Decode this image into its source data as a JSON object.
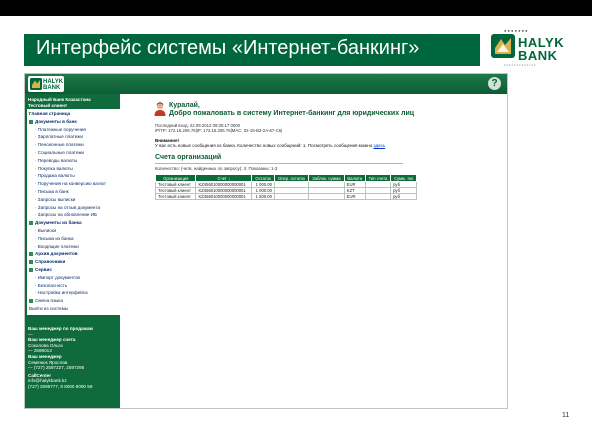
{
  "slide": {
    "title": "Интерфейс системы «Интернет-банкинг»",
    "page_number": "11",
    "brand_color": "#00673c"
  },
  "logo": {
    "dots": "●  ●  ●  ●  ●  ●  ●",
    "line1": "HALYK",
    "line2": "BANK",
    "tagline": "• • • • • • • • • • • • •"
  },
  "app": {
    "logo_line1": "HALYK",
    "logo_line2": "BANK",
    "help_icon": "?",
    "bank_name": "Народный Банк Казахстана",
    "client_name": "Тестовый клиент"
  },
  "menu": [
    {
      "label": "Главная страница",
      "bold": true,
      "icon": false
    },
    {
      "label": "Документы в банк",
      "bold": true,
      "icon": true
    },
    {
      "label": "· Платежные поручения",
      "bold": false,
      "icon": false
    },
    {
      "label": "· Зарплатные платежи",
      "bold": false,
      "icon": false
    },
    {
      "label": "· Пенсионные платежи",
      "bold": false,
      "icon": false
    },
    {
      "label": "· Социальные платежи",
      "bold": false,
      "icon": false
    },
    {
      "label": "· Переводы валюты",
      "bold": false,
      "icon": false
    },
    {
      "label": "· Покупка валюты",
      "bold": false,
      "icon": false
    },
    {
      "label": "· Продажа валюты",
      "bold": false,
      "icon": false
    },
    {
      "label": "· Поручения на конверсию валют",
      "bold": false,
      "icon": false
    },
    {
      "label": "· Письма в банк",
      "bold": false,
      "icon": false
    },
    {
      "label": "· Запросы выписки",
      "bold": false,
      "icon": false
    },
    {
      "label": "· Запросы на отзыв документа",
      "bold": false,
      "icon": false
    },
    {
      "label": "· Запросы на обновление ИБ",
      "bold": false,
      "icon": false
    },
    {
      "label": "Документы из банка",
      "bold": true,
      "icon": true
    },
    {
      "label": "· Выписки",
      "bold": false,
      "icon": false
    },
    {
      "label": "· Письма из банка",
      "bold": false,
      "icon": false
    },
    {
      "label": "· Входящие платежи",
      "bold": false,
      "icon": false
    },
    {
      "label": "Архив документов",
      "bold": true,
      "icon": true
    },
    {
      "label": "Справочники",
      "bold": true,
      "icon": true
    },
    {
      "label": "Сервис",
      "bold": true,
      "icon": true
    },
    {
      "label": "· Импорт документов",
      "bold": false,
      "icon": false
    },
    {
      "label": "· Безопасность",
      "bold": false,
      "icon": false
    },
    {
      "label": "· Настройка интерфейса",
      "bold": false,
      "icon": false
    },
    {
      "label": "Смена языка",
      "bold": false,
      "icon": true
    },
    {
      "label": "Выйти из системы",
      "bold": false,
      "icon": false
    }
  ],
  "contacts": {
    "sales_manager_title": "Ваш менеджер по продажам",
    "sales_manager_value": "—",
    "account_manager_title": "Ваш менеджер счета",
    "account_manager_name": "Соколова Ольга",
    "account_manager_phone": "— 2599013",
    "director_title": "Ваш менеджер",
    "director_name": "Семенюк Ярослав",
    "director_phone": "— (727) 2597227, 2597295",
    "callcenter_title": "CallCenter",
    "callcenter_email": "info@halykbank.kz",
    "callcenter_phones": "(727) 2598777, 8 8000 8000 59"
  },
  "welcome": {
    "name": "Куралай,",
    "line": "Добро пожаловать в систему Интернет-банкинг для юридических лиц",
    "last_login": "Последний вход: 22.09.2012 09:35:17 0000",
    "ip": "IP/TP: 172.16.206.76|IP: 172.16.206.76|MAC: 02-15-B2-2A-67-C6|",
    "attention": "Внимание!",
    "messages": "У вас есть новые сообщения из банка. Количество новых сообщений: 1. Посмотреть сообщения можно",
    "messages_link": "здесь"
  },
  "accounts": {
    "title": "Счета организаций",
    "filter": "Количество: (четв, найденных по запросу): 3.   Показаны: 1-3",
    "columns": [
      "Организация",
      "Счет  ↓",
      "Остаток",
      "Опер. остаток",
      "Заблок. сумма",
      "Валюта",
      "Тип счета",
      "Сумм. тек"
    ],
    "rows": [
      [
        "Тестовый клиент",
        "KZ456010000000000001",
        "1 000.00",
        "",
        "",
        "EUR",
        "",
        "руб"
      ],
      [
        "Тестовый клиент",
        "KZ456010000000000001",
        "1 000.00",
        "",
        "",
        "KZT",
        "",
        "руб"
      ],
      [
        "Тестовый клиент",
        "KZ456010000000000001",
        "1 500.00",
        "",
        "",
        "EUR",
        "",
        "руб"
      ]
    ]
  }
}
